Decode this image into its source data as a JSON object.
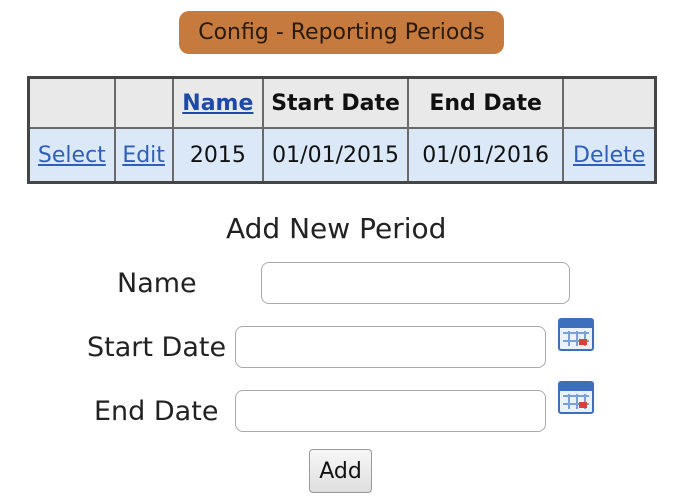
{
  "page": {
    "title": "Config - Reporting Periods"
  },
  "grid": {
    "headers": [
      "",
      "",
      "Name",
      "Start Date",
      "End Date",
      ""
    ],
    "rows": [
      {
        "select_label": "Select",
        "edit_label": "Edit",
        "name": "2015",
        "start_date": "01/01/2015",
        "end_date": "01/01/2016",
        "delete_label": "Delete"
      }
    ]
  },
  "form": {
    "heading": "Add New Period",
    "name_label": "Name",
    "name_value": "",
    "start_date_label": "Start Date",
    "start_date_value": "",
    "end_date_label": "End Date",
    "end_date_value": "",
    "add_label": "Add"
  },
  "icons": {
    "start_calendar": "calendar-icon",
    "end_calendar": "calendar-icon"
  },
  "colors": {
    "title_bg": "#c67a3d",
    "header_bg": "#e9e9e9",
    "row_bg": "#dbe8f7",
    "link": "#2f5fb8"
  }
}
